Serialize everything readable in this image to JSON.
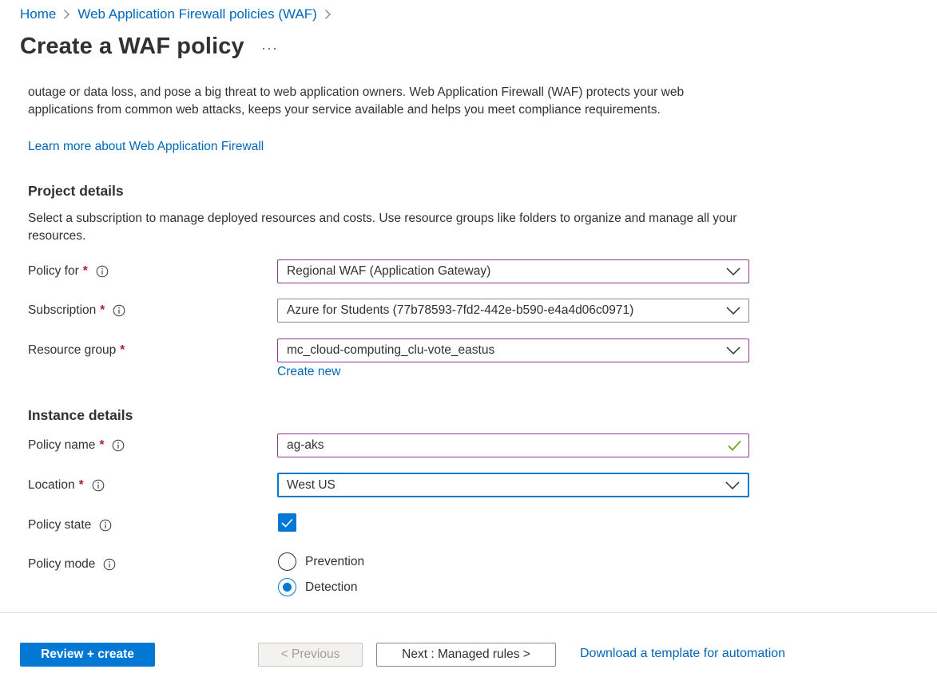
{
  "breadcrumb": {
    "home": "Home",
    "parent": "Web Application Firewall policies (WAF)"
  },
  "page": {
    "title": "Create a WAF policy",
    "more_label": "···"
  },
  "intro": {
    "text": "outage or data loss, and pose a big threat to web application owners. Web Application Firewall (WAF) protects your web applications from common web attacks, keeps your service available and helps you meet compliance requirements.",
    "learn_more": "Learn more about Web Application Firewall"
  },
  "project": {
    "title": "Project details",
    "description": "Select a subscription to manage deployed resources and costs. Use resource groups like folders to organize and manage all your resources.",
    "policy_for": {
      "label": "Policy for",
      "required": "*",
      "value": "Regional WAF (Application Gateway)"
    },
    "subscription": {
      "label": "Subscription",
      "required": "*",
      "value": "Azure for Students (77b78593-7fd2-442e-b590-e4a4d06c0971)"
    },
    "resource_group": {
      "label": "Resource group",
      "required": "*",
      "value": "mc_cloud-computing_clu-vote_eastus",
      "create_new": "Create new"
    }
  },
  "instance": {
    "title": "Instance details",
    "policy_name": {
      "label": "Policy name",
      "required": "*",
      "value": "ag-aks"
    },
    "location": {
      "label": "Location",
      "required": "*",
      "value": "West US"
    },
    "policy_state": {
      "label": "Policy state",
      "checked": true
    },
    "policy_mode": {
      "label": "Policy mode",
      "options": [
        "Prevention",
        "Detection"
      ],
      "selected": "Detection"
    }
  },
  "footer": {
    "review_create": "Review + create",
    "previous": "< Previous",
    "next": "Next : Managed rules >",
    "download": "Download a template for automation"
  },
  "colors": {
    "accent": "#0078d4",
    "link": "#0067b8",
    "required": "#a4262c",
    "valid_check": "#57a300",
    "field_border": "#8a3a8f"
  }
}
